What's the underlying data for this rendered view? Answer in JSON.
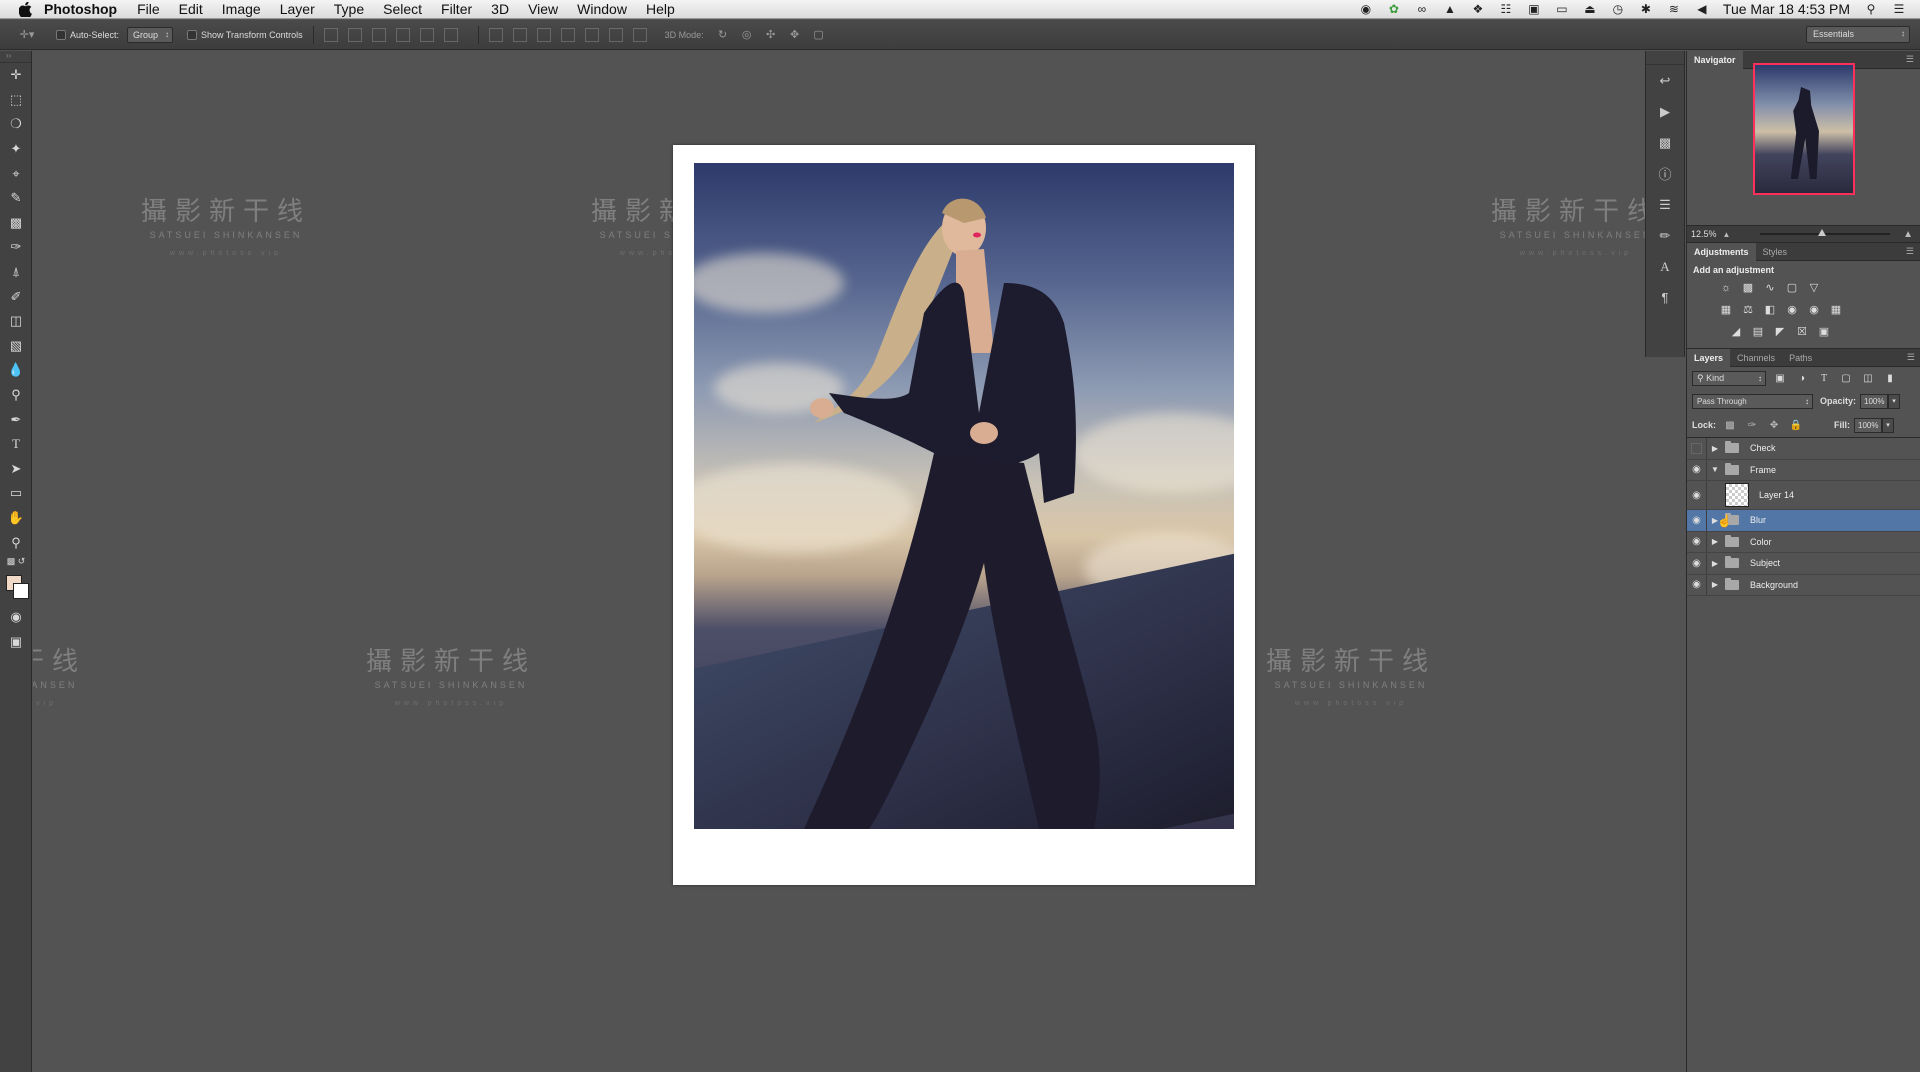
{
  "menubar": {
    "app_name": "Photoshop",
    "menus": [
      "File",
      "Edit",
      "Image",
      "Layer",
      "Type",
      "Select",
      "Filter",
      "3D",
      "View",
      "Window",
      "Help"
    ],
    "clock": "Tue Mar 18  4:53 PM"
  },
  "options": {
    "auto_select_label": "Auto-Select:",
    "auto_select_value": "Group",
    "transform_controls_label": "Show Transform Controls",
    "mode_3d_label": "3D Mode:",
    "workspace": "Essentials"
  },
  "watermark": {
    "title": "攝影新干线",
    "subtitle": "SATSUEI SHINKANSEN",
    "url": "www.photoss.vip"
  },
  "navigator": {
    "tab": "Navigator",
    "zoom": "12.5%"
  },
  "adjustments": {
    "tabs": [
      "Adjustments",
      "Styles"
    ],
    "heading": "Add an adjustment"
  },
  "layers_panel": {
    "tabs": [
      "Layers",
      "Channels",
      "Paths"
    ],
    "kind_filter": "Kind",
    "blend_mode": "Pass Through",
    "opacity_label": "Opacity:",
    "opacity_value": "100%",
    "lock_label": "Lock:",
    "fill_label": "Fill:",
    "fill_value": "100%",
    "layers": [
      {
        "name": "Check",
        "type": "group",
        "visible": false,
        "expanded": false
      },
      {
        "name": "Frame",
        "type": "group",
        "visible": true,
        "expanded": true
      },
      {
        "name": "Layer 14",
        "type": "layer",
        "visible": true
      },
      {
        "name": "Blur",
        "type": "group",
        "visible": true,
        "expanded": false,
        "selected": true
      },
      {
        "name": "Color",
        "type": "group",
        "visible": true,
        "expanded": false
      },
      {
        "name": "Subject",
        "type": "group",
        "visible": true,
        "expanded": false
      },
      {
        "name": "Background",
        "type": "group",
        "visible": true,
        "expanded": false
      }
    ]
  },
  "colors": {
    "foreground": "#f1d9c8",
    "background": "#ffffff",
    "selection": "#5277a6",
    "navigator_frame": "#ff2f5c"
  }
}
